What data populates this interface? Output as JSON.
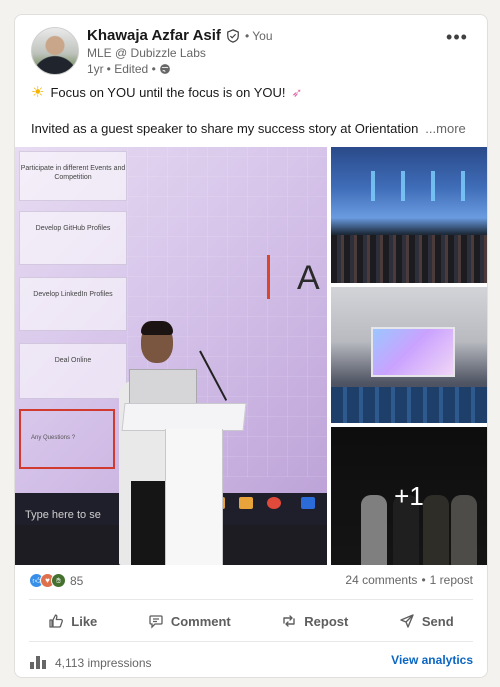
{
  "author": {
    "name": "Khawaja Azfar Asif",
    "you_label": "• You",
    "headline": "MLE @ Dubizzle Labs",
    "time": "1yr",
    "edited": "• Edited •"
  },
  "post": {
    "line1": "Focus on YOU until the focus is on YOU!",
    "line2": "Invited as a guest speaker to share my success story at Orientation",
    "see_more": "...more"
  },
  "gallery": {
    "slide_labels": [
      "Participate in different Events and Competition",
      "Develop GitHub Profiles",
      "Develop LinkedIn Profiles",
      "Deal Online",
      "Any Questions ?"
    ],
    "slide_letter": "A",
    "taskbar_search": "Type here to se",
    "extra_count": "+1"
  },
  "social": {
    "reaction_count": "85",
    "comments": "24 comments",
    "separator": "•",
    "reposts": "1 repost"
  },
  "actions": {
    "like": "Like",
    "comment": "Comment",
    "repost": "Repost",
    "send": "Send"
  },
  "footer": {
    "impressions": "4,113 impressions",
    "view_analytics": "View analytics"
  },
  "colors": {
    "link": "#0a66c2",
    "muted": "#666666"
  }
}
